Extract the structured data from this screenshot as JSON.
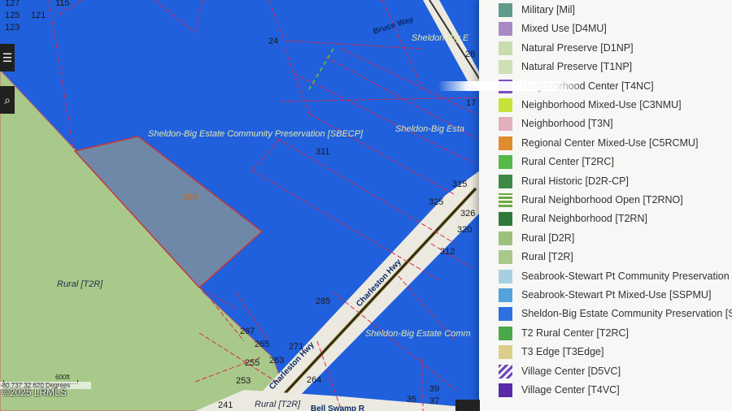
{
  "map": {
    "zone_labels": [
      "Sheldon-Big Estate Community Preservation [SBECP]",
      "Sheldon-Big Esta",
      "Sheldon-Big E",
      "Sheldon-Big Estate Comm",
      "Rural [T2R]",
      "Rural [T2R]"
    ],
    "road_labels": [
      "Bruce Way",
      "Charleston Hwy",
      "Charleston Hwy",
      "Bell Swamp R"
    ],
    "parcel_numbers": [
      "127",
      "115",
      "125",
      "121",
      "123",
      "24",
      "28",
      "17",
      "311",
      "269",
      "315",
      "325",
      "326",
      "320",
      "312",
      "285",
      "267",
      "265",
      "271",
      "263",
      "255",
      "253",
      "264",
      "241",
      "35",
      "37",
      "39"
    ],
    "scale_text": "600ft",
    "coordinates": "-80.737 32.620 Degrees"
  },
  "toolbar": {
    "menu_icon": "menu-icon",
    "search_icon": "search-icon"
  },
  "copyright": "©2025 LRMLS",
  "legend": {
    "items": [
      {
        "label": "Military [Mil]",
        "color": "#5f9a8a"
      },
      {
        "label": "Mixed Use [D4MU]",
        "color": "#a78ac4"
      },
      {
        "label": "Natural Preserve [D1NP]",
        "color": "#c9dcae"
      },
      {
        "label": "Natural Preserve [T1NP]",
        "color": "#cfdfb6"
      },
      {
        "label": "Neighborhood Center [T4NC]",
        "color": "#7a4fc0"
      },
      {
        "label": "Neighborhood Mixed-Use [C3NMU]",
        "color": "#c7e23a"
      },
      {
        "label": "Neighborhood [T3N]",
        "color": "#e2b1bd"
      },
      {
        "label": "Regional Center Mixed-Use [C5RCMU]",
        "color": "#df8c2c"
      },
      {
        "label": "Rural Center [T2RC]",
        "color": "#55b84a"
      },
      {
        "label": "Rural Historic [D2R-CP]",
        "color": "#3f8a47"
      },
      {
        "label": "Rural Neighborhood Open [T2RNO]",
        "color": "#6cab3e"
      },
      {
        "label": "Rural Neighborhood [T2RN]",
        "color": "#2f7a3a"
      },
      {
        "label": "Rural [D2R]",
        "color": "#9dc07a"
      },
      {
        "label": "Rural [T2R]",
        "color": "#a9c98a"
      },
      {
        "label": "Seabrook-Stewart Pt Community Preservation [S",
        "color": "#a6d0e2"
      },
      {
        "label": "Seabrook-Stewart Pt Mixed-Use [SSPMU]",
        "color": "#53a3dd"
      },
      {
        "label": "Sheldon-Big Estate Community Preservation [S",
        "color": "#2f6fe0"
      },
      {
        "label": "T2 Rural Center [T2RC]",
        "color": "#4aa84a"
      },
      {
        "label": "T3 Edge [T3Edge]",
        "color": "#d9cf8a"
      },
      {
        "label": "Village Center [D5VC]",
        "color": "#6d46b8"
      },
      {
        "label": "Village Center [T4VC]",
        "color": "#5a2aa8"
      }
    ]
  }
}
